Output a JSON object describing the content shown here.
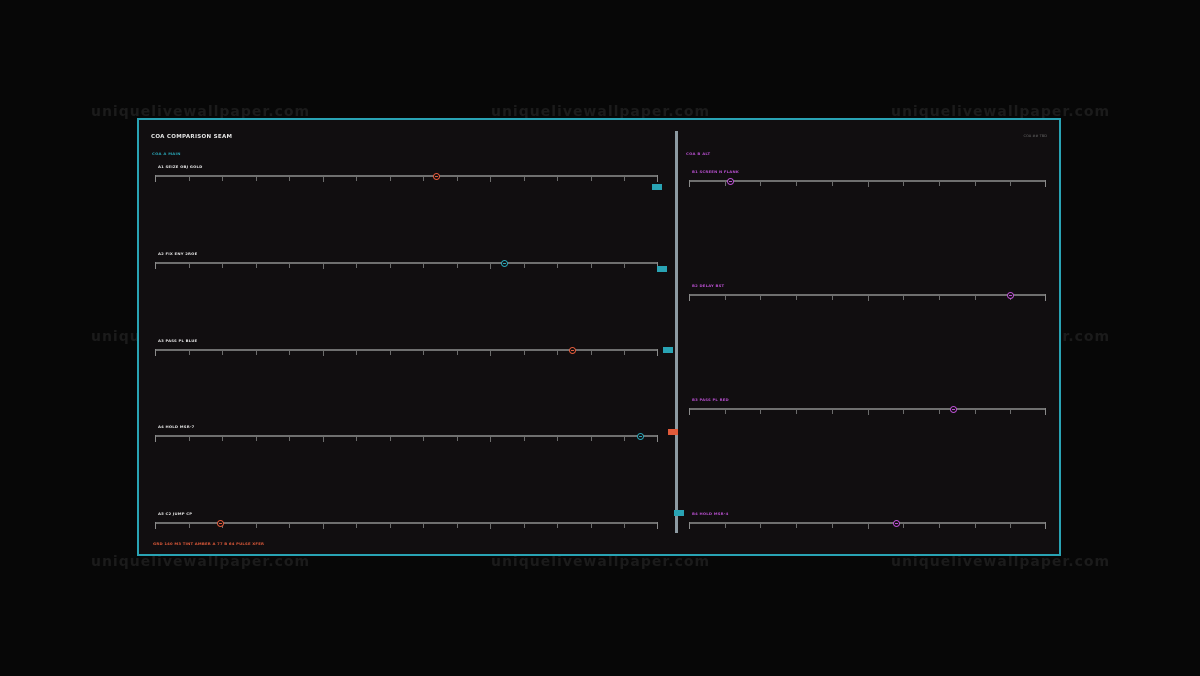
{
  "watermark": "uniquelivewallpaper.com",
  "panel": {
    "title": "COA COMPARISON SEAM",
    "top_right": "COA ## TBD",
    "left_header": "COA A MAIN",
    "right_header": "COA B ALT",
    "footer": "GRD 140 M3 TINT AMBER A 77 B 64 PULSE XFER"
  },
  "left_tracks": [
    {
      "label": "A1 SEIZE OBJ GOLD",
      "value": 0.56,
      "color": "#e05a3a"
    },
    {
      "label": "A2 FIX ENY 2ROE",
      "value": 0.695,
      "color": "#29a3b4"
    },
    {
      "label": "A3 PASS PL BLUE",
      "value": 0.83,
      "color": "#e05a3a"
    },
    {
      "label": "A4 HOLD MSR-7",
      "value": 0.965,
      "color": "#29a3b4"
    },
    {
      "label": "A5 C2 JUMP CP",
      "value": 0.13,
      "color": "#e05a3a"
    }
  ],
  "right_tracks": [
    {
      "label": "B1 SCREEN N FLANK",
      "value": 0.115,
      "color": "#b84fcf"
    },
    {
      "label": "B2 DELAY BST",
      "value": 0.9,
      "color": "#b84fcf"
    },
    {
      "label": "B3 PASS PL RED",
      "value": 0.74,
      "color": "#b84fcf"
    },
    {
      "label": "B4 HOLD MSR-4",
      "value": 0.58,
      "color": "#b84fcf"
    }
  ],
  "seam_markers": [
    {
      "color": "#29a3b4"
    },
    {
      "color": "#29a3b4"
    },
    {
      "color": "#29a3b4"
    },
    {
      "color": "#e05a3a"
    },
    {
      "color": "#29a3b4"
    }
  ],
  "colors": {
    "accent_cyan": "#29a3b4",
    "accent_orange": "#e05a3a",
    "accent_purple": "#b84fcf",
    "panel_bg": "#110e10",
    "page_bg": "#070707"
  }
}
